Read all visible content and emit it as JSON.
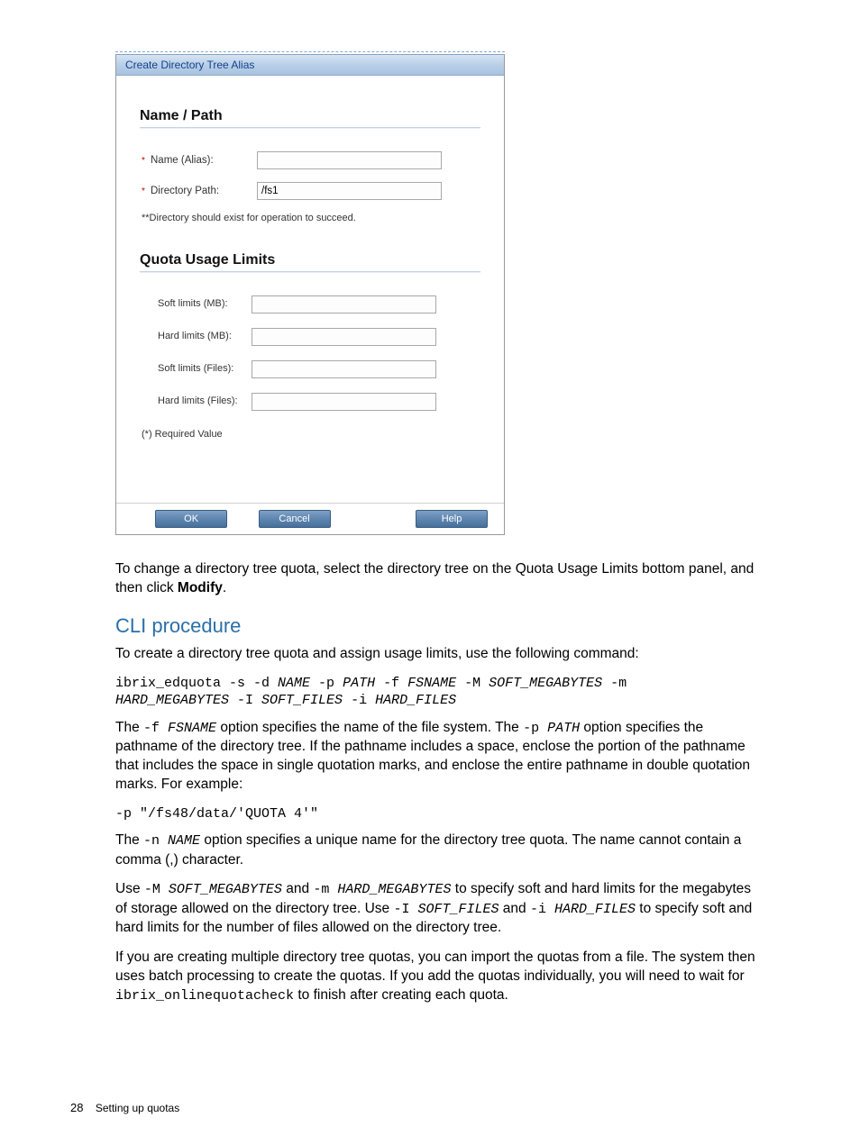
{
  "dialog": {
    "title": "Create Directory Tree Alias",
    "section_name_path": "Name / Path",
    "name_label": "Name (Alias):",
    "name_value": "",
    "dirpath_label": "Directory Path:",
    "dirpath_value": "/fs1",
    "dir_note": "**Directory should exist for operation to succeed.",
    "section_quota": "Quota Usage Limits",
    "soft_mb_label": "Soft limits (MB):",
    "hard_mb_label": "Hard limits (MB):",
    "soft_files_label": "Soft limits (Files):",
    "hard_files_label": "Hard limits (Files):",
    "required_note": "(*) Required Value",
    "buttons": {
      "ok": "OK",
      "cancel": "Cancel",
      "help": "Help"
    }
  },
  "text": {
    "para_modify_1": "To change a directory tree quota, select the directory tree on the Quota Usage Limits bottom panel, and then click ",
    "para_modify_bold": "Modify",
    "para_modify_2": ".",
    "heading_cli": "CLI procedure",
    "para_cli_intro": "To create a directory tree quota and assign usage limits, use the following command:",
    "cmd1_a": "ibrix_edquota -s -d ",
    "cmd1_name": "NAME",
    "cmd1_b": " -p ",
    "cmd1_path": "PATH",
    "cmd1_c": " -f ",
    "cmd1_fsname": "FSNAME",
    "cmd1_d": " -M ",
    "cmd1_softmb": "SOFT_MEGABYTES",
    "cmd1_e": " -m ",
    "cmd1_hardmb": "HARD_MEGABYTES",
    "cmd1_f": " -I ",
    "cmd1_softfiles": "SOFT_FILES",
    "cmd1_g": " -i ",
    "cmd1_hardfiles": "HARD_FILES",
    "para_fsname_1": "The ",
    "code_f": "-f ",
    "code_fsname_it": "FSNAME",
    "para_fsname_2": " option specifies the name of the file system. The ",
    "code_p": "-p ",
    "code_path_it": "PATH",
    "para_fsname_3": " option specifies the pathname of the directory tree. If the pathname includes a space, enclose the portion of the pathname that includes the space in single quotation marks, and enclose the entire pathname in double quotation marks. For example:",
    "cmd2": "-p \"/fs48/data/'QUOTA 4'\"",
    "para_name_1": "The ",
    "code_n": "-n ",
    "code_name_it": "NAME",
    "para_name_2": " option specifies a unique name for the directory tree quota. The name cannot contain a comma (,) character.",
    "para_use_1": "Use ",
    "code_M": "-M ",
    "code_softmb_it": "SOFT_MEGABYTES",
    "para_use_2": " and ",
    "code_m": "-m ",
    "code_hardmb_it": "HARD_MEGABYTES",
    "para_use_3": " to specify soft and hard limits for the megabytes of storage allowed on the directory tree. Use ",
    "code_I": "-I ",
    "code_softfiles_it": "SOFT_FILES",
    "para_use_4": " and ",
    "code_i": "-i ",
    "code_hardfiles_it": "HARD_FILES",
    "para_use_5": " to specify soft and hard limits for the number of files allowed on the directory tree.",
    "para_batch_1": "If you are creating multiple directory tree quotas, you can import the quotas from a file. The system then uses batch processing to create the quotas. If you add the quotas individually, you will need to wait for ",
    "code_onlinecheck": "ibrix_onlinequotacheck",
    "para_batch_2": " to finish after creating each quota."
  },
  "footer": {
    "page_number": "28",
    "section": "Setting up quotas"
  }
}
